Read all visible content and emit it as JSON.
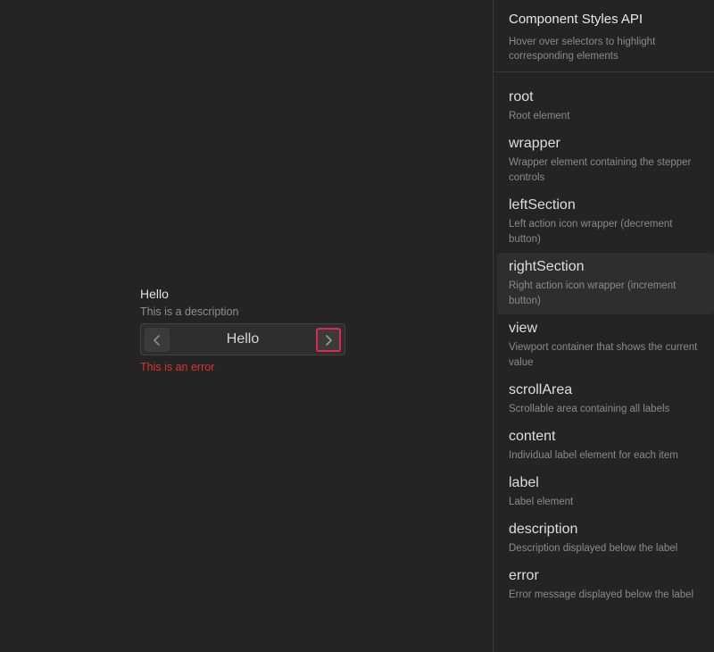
{
  "field": {
    "label": "Hello",
    "description": "This is a description",
    "value": "Hello",
    "error": "This is an error"
  },
  "colors": {
    "background": "#242424",
    "error": "#e03131",
    "highlight": "#e0245e"
  },
  "panel": {
    "title": "Component Styles API",
    "subtitle": "Hover over selectors to highlight corresponding elements",
    "selectors": [
      {
        "name": "root",
        "desc": "Root element"
      },
      {
        "name": "wrapper",
        "desc": "Wrapper element containing the stepper controls"
      },
      {
        "name": "leftSection",
        "desc": "Left action icon wrapper (decrement button)"
      },
      {
        "name": "rightSection",
        "desc": "Right action icon wrapper (increment button)"
      },
      {
        "name": "view",
        "desc": "Viewport container that shows the current value"
      },
      {
        "name": "scrollArea",
        "desc": "Scrollable area containing all labels"
      },
      {
        "name": "content",
        "desc": "Individual label element for each item"
      },
      {
        "name": "label",
        "desc": "Label element"
      },
      {
        "name": "description",
        "desc": "Description displayed below the label"
      },
      {
        "name": "error",
        "desc": "Error message displayed below the label"
      }
    ]
  },
  "icons": {
    "decrement": "chevron-left-icon",
    "increment": "chevron-right-icon"
  }
}
